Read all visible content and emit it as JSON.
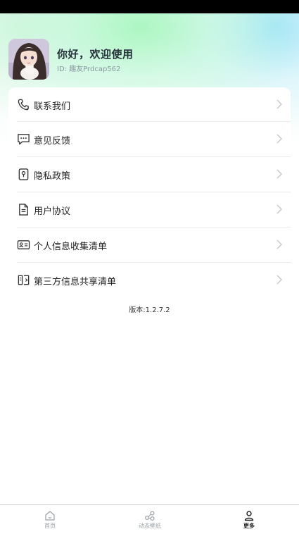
{
  "profile": {
    "greeting": "你好，欢迎使用",
    "user_id": "ID: 趣友Prdcap562"
  },
  "menu": {
    "items": [
      {
        "label": "联系我们",
        "icon": "phone-icon"
      },
      {
        "label": "意见反馈",
        "icon": "chat-bubble-icon"
      },
      {
        "label": "隐私政策",
        "icon": "privacy-lock-icon"
      },
      {
        "label": "用户协议",
        "icon": "document-icon"
      },
      {
        "label": "个人信息收集清单",
        "icon": "id-card-icon"
      },
      {
        "label": "第三方信息共享清单",
        "icon": "share-list-icon"
      }
    ]
  },
  "version": "版本:1.2.7.2",
  "bottom_nav": {
    "items": [
      {
        "label": "首页",
        "icon": "home-icon",
        "active": false
      },
      {
        "label": "动态壁纸",
        "icon": "wallpaper-icon",
        "active": false
      },
      {
        "label": "更多",
        "icon": "user-icon",
        "active": true
      }
    ]
  },
  "colors": {
    "accent_green": "#a8f6be",
    "accent_blue": "#96e1fa",
    "text_primary": "#26313b",
    "text_secondary": "#8a97a0"
  }
}
